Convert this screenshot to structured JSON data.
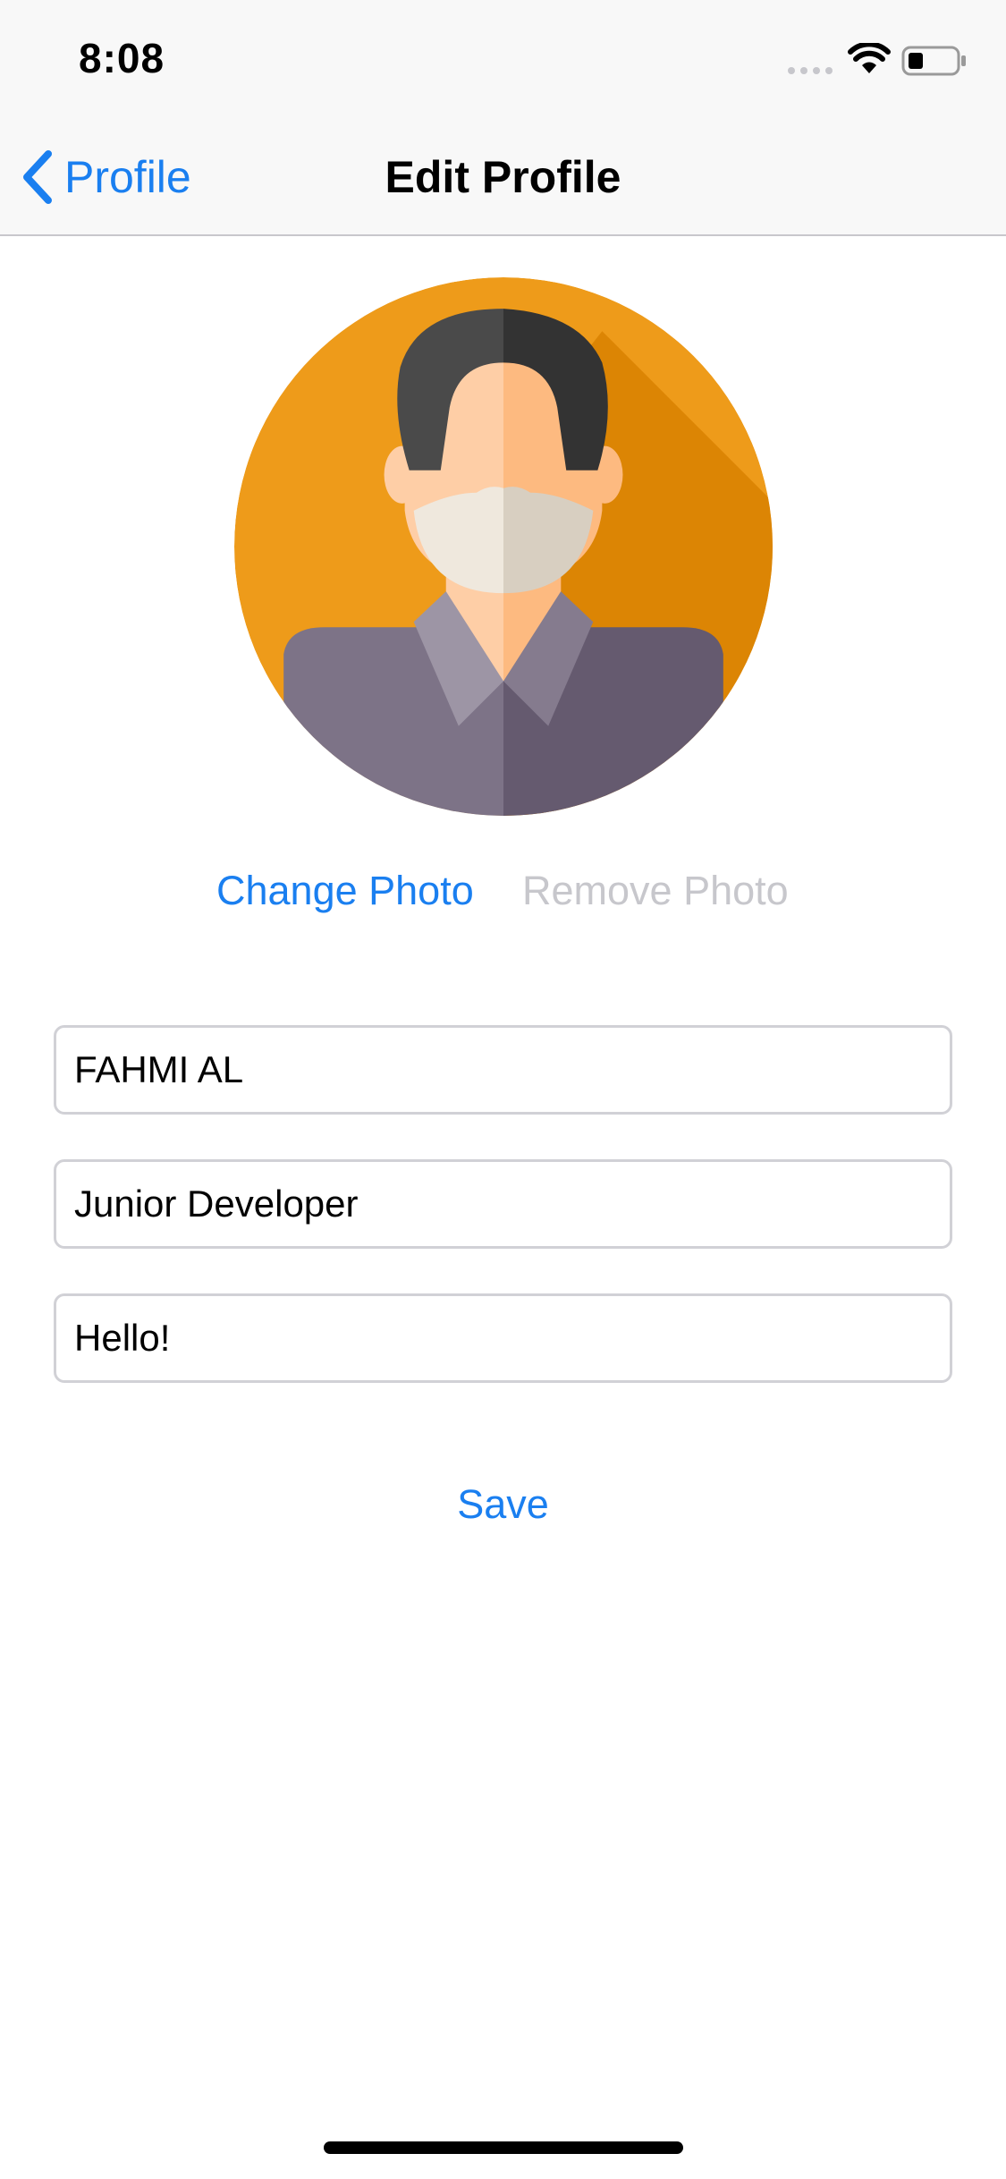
{
  "status_bar": {
    "time": "8:08",
    "signal_icon": "cellular-signal-icon",
    "wifi_icon": "wifi-icon",
    "battery_icon": "battery-icon"
  },
  "nav": {
    "back_label": "Profile",
    "back_icon": "chevron-left-icon",
    "title": "Edit Profile"
  },
  "avatar": {
    "icon": "person-with-mask-avatar",
    "colors": {
      "background": "#EE9B1A",
      "shadow": "#DC8504",
      "hair_left": "#4A4A4A",
      "hair_right": "#333333",
      "skin_left": "#FECEA6",
      "skin_right": "#FDBA80",
      "mask_left": "#EFE8DD",
      "mask_right": "#D8CFC1",
      "shirt_left": "#7D7387",
      "shirt_right": "#655A6F",
      "collar": "#9D95A5"
    }
  },
  "photo_actions": {
    "change_label": "Change Photo",
    "remove_label": "Remove Photo"
  },
  "form": {
    "name_value": "FAHMI AL",
    "title_value": "Junior Developer",
    "bio_value": "Hello!"
  },
  "save_label": "Save",
  "colors": {
    "accent": "#1A7FF0",
    "disabled": "#C7C7CC",
    "border": "#D1D1D6"
  }
}
